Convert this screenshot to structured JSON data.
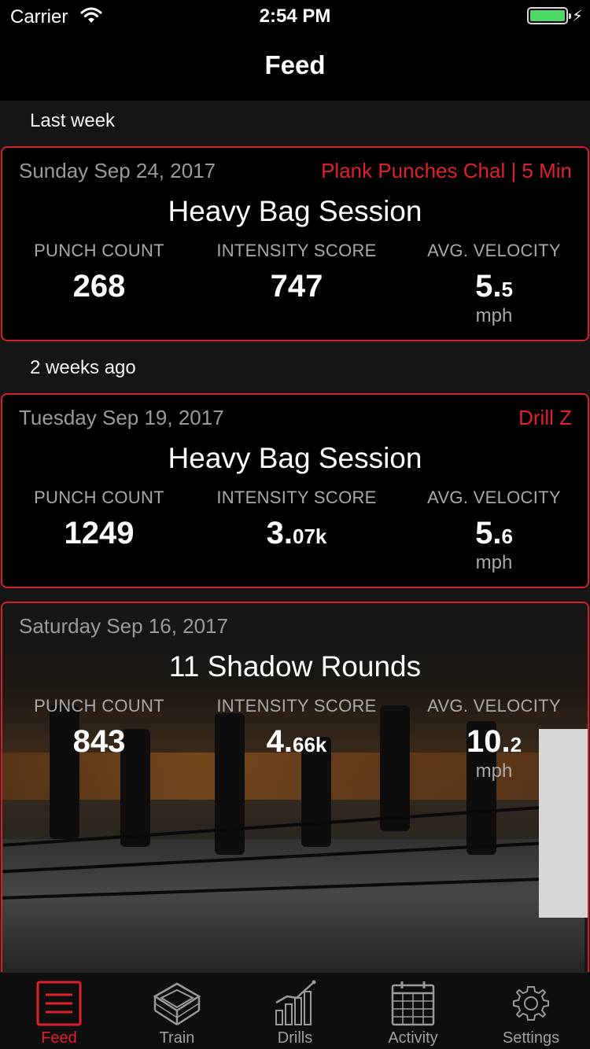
{
  "status_bar": {
    "carrier": "Carrier",
    "time": "2:54 PM",
    "battery_level": 1.0
  },
  "nav": {
    "title": "Feed"
  },
  "sections": [
    {
      "header": "Last week"
    },
    {
      "header": "2 weeks ago"
    }
  ],
  "cards": [
    {
      "date": "Sunday Sep 24, 2017",
      "tag": "Plank Punches Chal | 5 Min",
      "title": "Heavy Bag Session",
      "stats": [
        {
          "label": "PUNCH COUNT",
          "value_main": "268",
          "value_small": ""
        },
        {
          "label": "INTENSITY SCORE",
          "value_main": "747",
          "value_small": ""
        },
        {
          "label": "AVG. VELOCITY",
          "value_main": "5.",
          "value_small": "5",
          "unit": "mph"
        }
      ]
    },
    {
      "date": "Tuesday Sep 19, 2017",
      "tag": "Drill Z",
      "title": "Heavy Bag Session",
      "stats": [
        {
          "label": "PUNCH COUNT",
          "value_main": "1249",
          "value_small": ""
        },
        {
          "label": "INTENSITY SCORE",
          "value_main": "3.",
          "value_small": "07k"
        },
        {
          "label": "AVG. VELOCITY",
          "value_main": "5.",
          "value_small": "6",
          "unit": "mph"
        }
      ]
    },
    {
      "date": "Saturday Sep 16, 2017",
      "tag": "",
      "title": "11 Shadow Rounds",
      "stats": [
        {
          "label": "PUNCH COUNT",
          "value_main": "843",
          "value_small": ""
        },
        {
          "label": "INTENSITY SCORE",
          "value_main": "4.",
          "value_small": "66k"
        },
        {
          "label": "AVG. VELOCITY",
          "value_main": "10.",
          "value_small": "2",
          "unit": "mph"
        }
      ]
    }
  ],
  "tabs": [
    {
      "label": "Feed",
      "icon": "feed-icon",
      "active": true
    },
    {
      "label": "Train",
      "icon": "boxing-ring-icon",
      "active": false
    },
    {
      "label": "Drills",
      "icon": "chart-icon",
      "active": false
    },
    {
      "label": "Activity",
      "icon": "calendar-icon",
      "active": false
    },
    {
      "label": "Settings",
      "icon": "gear-icon",
      "active": false
    }
  ],
  "colors": {
    "accent": "#e0202a",
    "card_border": "#d0202a",
    "background": "#151515",
    "battery": "#4cd964"
  }
}
